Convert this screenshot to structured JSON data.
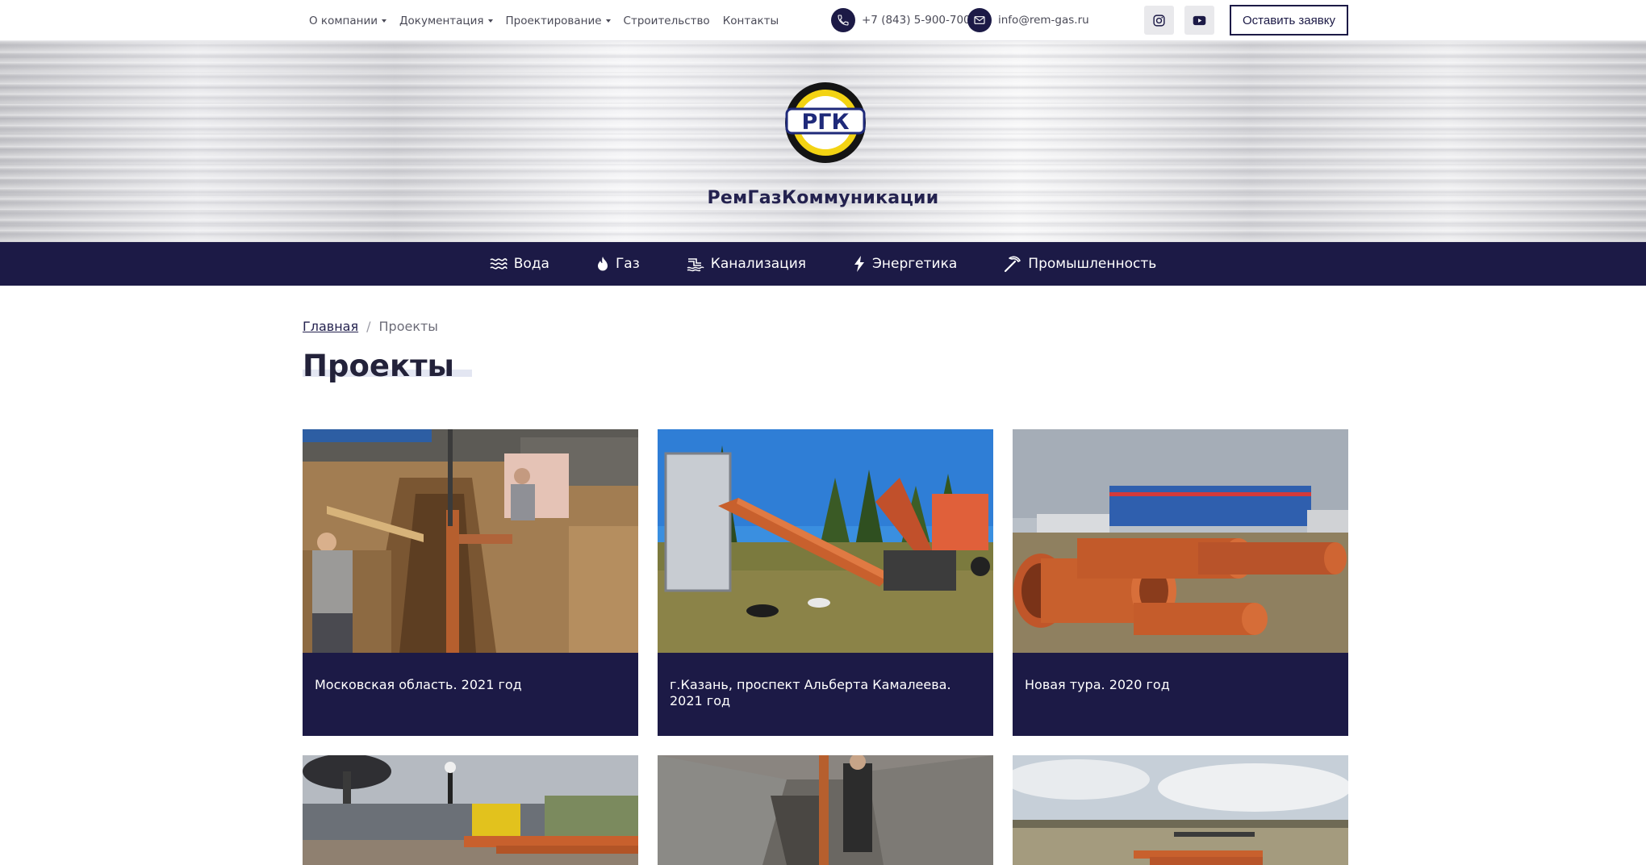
{
  "topbar": {
    "menu": [
      {
        "label": "О компании",
        "dropdown": true
      },
      {
        "label": "Документация",
        "dropdown": true
      },
      {
        "label": "Проектирование",
        "dropdown": true
      },
      {
        "label": "Строительство",
        "dropdown": false
      },
      {
        "label": "Контакты",
        "dropdown": false
      }
    ],
    "phone": "+7 (843) 5-900-700",
    "email": "info@rem-gas.ru",
    "cta_label": "Оставить заявку"
  },
  "hero": {
    "logo_text": "РГК",
    "brand_name": "РемГазКоммуникации"
  },
  "categories": [
    {
      "label": "Вода",
      "icon": "water-waves-icon"
    },
    {
      "label": "Газ",
      "icon": "flame-icon"
    },
    {
      "label": "Канализация",
      "icon": "sewer-icon"
    },
    {
      "label": "Энергетика",
      "icon": "lightning-icon"
    },
    {
      "label": "Промышленность",
      "icon": "pickaxe-icon"
    }
  ],
  "breadcrumb": {
    "home": "Главная",
    "separator": "/",
    "current": "Проекты"
  },
  "page_title": "Проекты",
  "projects": [
    {
      "caption": "Московская область. 2021 год"
    },
    {
      "caption": "г.Казань, проспект Альберта Камалеева. 2021 год"
    },
    {
      "caption": "Новая тура. 2020 год"
    },
    {
      "caption": ""
    },
    {
      "caption": ""
    },
    {
      "caption": ""
    }
  ],
  "colors": {
    "navy": "#1c1a46",
    "pipe_orange": "#c8602d",
    "logo_yellow": "#f3d313"
  }
}
